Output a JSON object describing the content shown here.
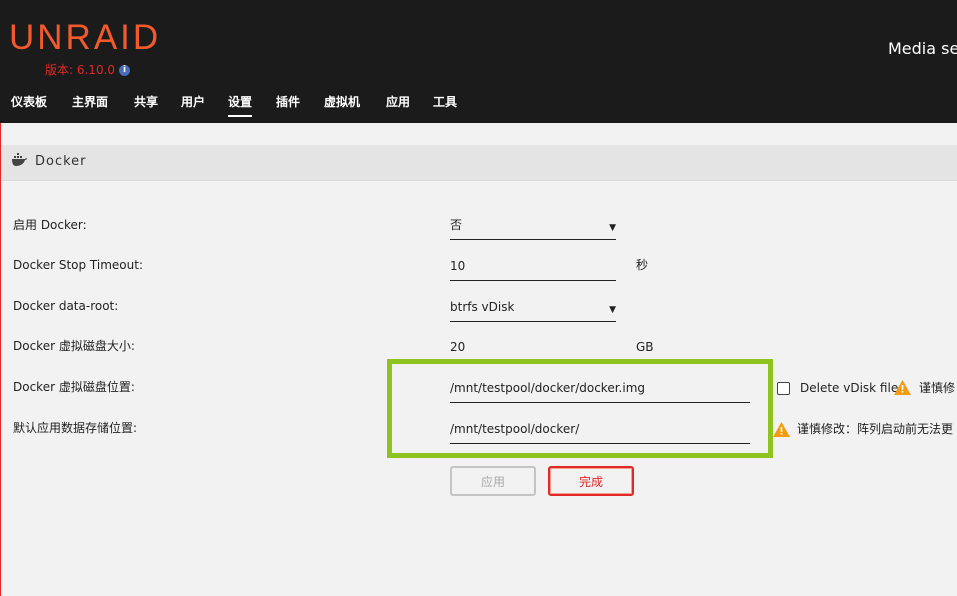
{
  "header": {
    "logo": "UNRAID",
    "version": "版本: 6.10.0",
    "info_icon": "i",
    "server_name": "Media se",
    "nav": [
      "仪表板",
      "主界面",
      "共享",
      "用户",
      "设置",
      "插件",
      "虚拟机",
      "应用",
      "工具"
    ],
    "active_nav": "设置"
  },
  "section": {
    "title": "Docker",
    "icon": "docker-icon"
  },
  "form": {
    "enable_docker": {
      "label": "启用 Docker:",
      "value": "否"
    },
    "stop_timeout": {
      "label": "Docker Stop Timeout:",
      "value": "10",
      "unit": "秒"
    },
    "data_root": {
      "label": "Docker data-root:",
      "value": "btrfs vDisk"
    },
    "vdisk_size": {
      "label": "Docker 虚拟磁盘大小:",
      "value": "20",
      "unit": "GB"
    },
    "vdisk_location": {
      "label": "Docker 虚拟磁盘位置:",
      "value": "/mnt/testpool/docker/docker.img",
      "delete_label": "Delete vDisk file",
      "warning": "谨慎修"
    },
    "appdata_location": {
      "label": "默认应用数据存储位置:",
      "value": "/mnt/testpool/docker/",
      "warning": "谨慎修改：阵列启动前无法更"
    }
  },
  "buttons": {
    "apply": "应用",
    "done": "完成"
  },
  "colors": {
    "brand": "#f15a2c",
    "header_bg": "#1c1b1b",
    "highlight": "#8fc31f",
    "warning": "#f39c12",
    "danger": "#e22828"
  }
}
